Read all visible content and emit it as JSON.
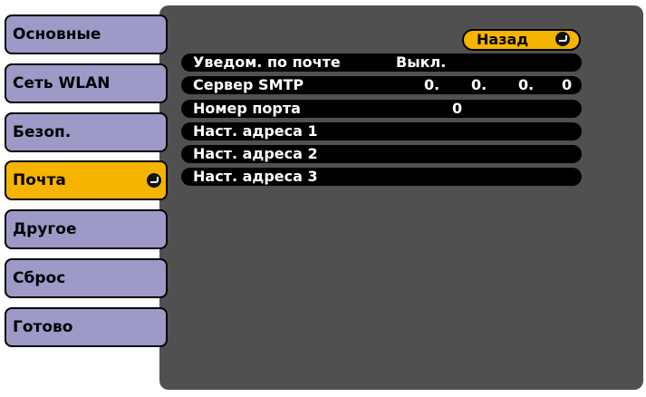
{
  "sidebar": {
    "items": [
      {
        "label": "Основные"
      },
      {
        "label": "Сеть WLAN"
      },
      {
        "label": "Безоп."
      },
      {
        "label": "Почта"
      },
      {
        "label": "Другое"
      },
      {
        "label": "Сброс"
      },
      {
        "label": "Готово"
      }
    ],
    "active_index": 3
  },
  "main": {
    "back_label": "Назад",
    "rows": [
      {
        "label": "Уведом. по почте",
        "value": "Выкл."
      },
      {
        "label": "Сервер SMTP",
        "values": [
          "0.",
          "0.",
          "0.",
          "0"
        ]
      },
      {
        "label": "Номер порта",
        "value": "0"
      },
      {
        "label": "Наст. адреса 1"
      },
      {
        "label": "Наст. адреса 2"
      },
      {
        "label": "Наст. адреса 3"
      }
    ]
  },
  "colors": {
    "tab": "#9d9ac8",
    "active": "#f5b400",
    "panel": "#505050",
    "row": "#000000"
  },
  "icons": {
    "enter": "enter-icon"
  }
}
